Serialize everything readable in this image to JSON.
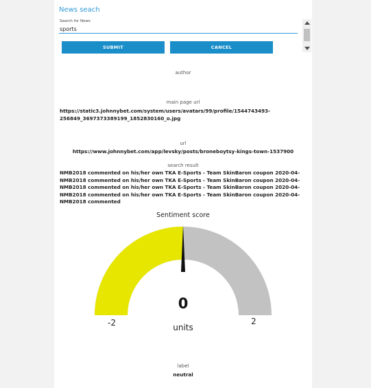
{
  "app": {
    "title": "News seach"
  },
  "search": {
    "label": "Search for News",
    "value": "sports"
  },
  "buttons": {
    "submit": "SUBMIT",
    "cancel": "CANCEL"
  },
  "results": {
    "author_label": "author",
    "main_page_url_label": "main page url",
    "main_page_url_line1": "https://static3.johnnybet.com/system/users/avatars/99/profile/1544743493-",
    "main_page_url_line2": "256849_3697373389199_1852830160_o.jpg",
    "url_label": "url",
    "url_value": "https://www.johnnybet.com/app/levsky/posts/broneboytsy-kings-town-1537900",
    "search_result_label": "search result",
    "search_result_lines": [
      "NMB2018 commented on his/her own TKA E-Sports - Team SkinBaron coupon 2020-04-05",
      "NMB2018 commented on his/her own TKA E-Sports - Team SkinBaron coupon 2020-04-05",
      "NMB2018 commented on his/her own TKA E-Sports - Team SkinBaron coupon 2020-04-05",
      "NMB2018 commented on his/her own TKA E-Sports - Team SkinBaron coupon 2020-04-05",
      "NMB2018 commented"
    ]
  },
  "gauge": {
    "title": "Sentiment score",
    "value": "0",
    "units": "units",
    "min_label": "-2",
    "max_label": "2",
    "min": -2,
    "max": 2,
    "current": 0,
    "fill_color": "#e6e600",
    "track_color": "#c2c2c2",
    "needle_color": "#111111"
  },
  "label": {
    "caption": "label",
    "value": "neutral"
  }
}
